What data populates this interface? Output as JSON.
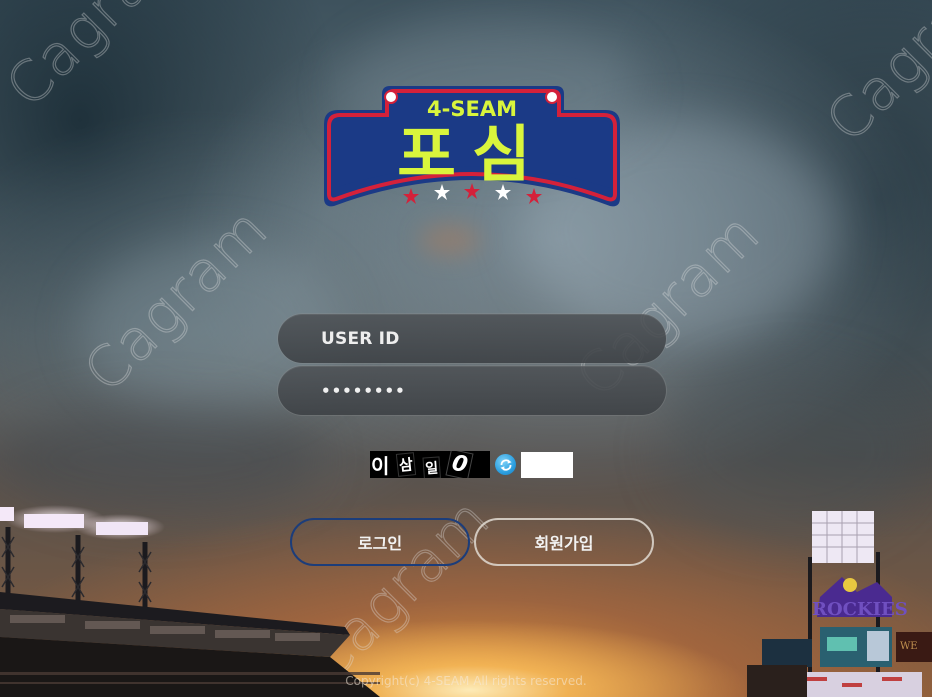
{
  "brand": {
    "name_en": "4-SEAM",
    "name_ko": "포심",
    "colors": {
      "navy": "#1b3a86",
      "red": "#d4213a",
      "lime": "#d9f53c",
      "white": "#ffffff"
    }
  },
  "watermark": "Cagram",
  "login": {
    "user_id_placeholder": "USER ID",
    "password_value": "••••••••",
    "captcha": {
      "chars": [
        "이",
        "삼",
        "일",
        "0"
      ],
      "refresh_icon": "refresh-icon",
      "input_value": ""
    },
    "login_label": "로그인",
    "join_label": "회원가입",
    "login_border_color": "#1c3d7a"
  },
  "footer": {
    "copyright": "Copyright(c) 4-SEAM All rights reserved."
  }
}
